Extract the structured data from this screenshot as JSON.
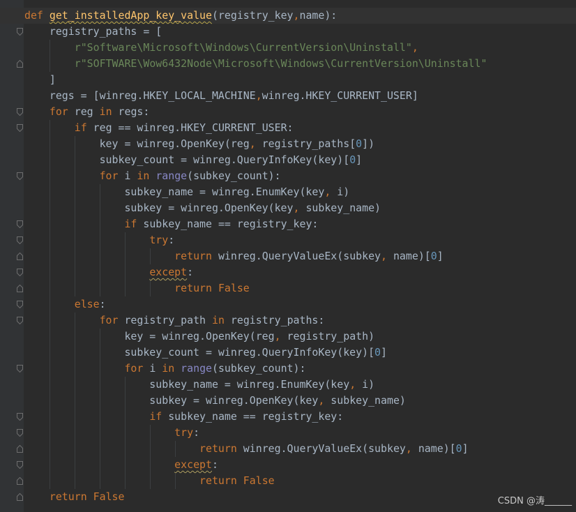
{
  "editor": {
    "language": "python",
    "colors": {
      "background": "#2b2b2b",
      "gutter": "#313335",
      "keyword": "#cc7832",
      "function": "#ffc66d",
      "string": "#6a8759",
      "number": "#6897bb",
      "builtin": "#8888c6",
      "default": "#a9b7c6"
    },
    "lines": [
      [
        {
          "t": "def ",
          "c": "kw"
        },
        {
          "t": "get_installedApp_key_value",
          "c": "fn-decl"
        },
        {
          "t": "(registry_key"
        },
        {
          "t": ",",
          "c": "punc"
        },
        {
          "t": "name):"
        }
      ],
      [
        {
          "t": "    registry_paths = ["
        }
      ],
      [
        {
          "t": "        "
        },
        {
          "t": "r\"Software\\Microsoft\\Windows\\CurrentVersion\\Uninstall\"",
          "c": "str"
        },
        {
          "t": ",",
          "c": "punc"
        }
      ],
      [
        {
          "t": "        "
        },
        {
          "t": "r\"SOFTWARE\\Wow6432Node\\Microsoft\\Windows\\CurrentVersion\\Uninstall\"",
          "c": "str"
        }
      ],
      [
        {
          "t": "    ]"
        }
      ],
      [
        {
          "t": "    regs = [winreg.HKEY_LOCAL_MACHINE"
        },
        {
          "t": ",",
          "c": "punc"
        },
        {
          "t": "winreg.HKEY_CURRENT_USER]"
        }
      ],
      [
        {
          "t": "    "
        },
        {
          "t": "for ",
          "c": "kw"
        },
        {
          "t": "reg "
        },
        {
          "t": "in ",
          "c": "kw"
        },
        {
          "t": "regs:"
        }
      ],
      [
        {
          "t": "        "
        },
        {
          "t": "if ",
          "c": "kw"
        },
        {
          "t": "reg == winreg.HKEY_CURRENT_USER:"
        }
      ],
      [
        {
          "t": "            key = winreg.OpenKey(reg"
        },
        {
          "t": ", ",
          "c": "punc"
        },
        {
          "t": "registry_paths["
        },
        {
          "t": "0",
          "c": "num"
        },
        {
          "t": "])"
        }
      ],
      [
        {
          "t": "            subkey_count = winreg.QueryInfoKey(key)["
        },
        {
          "t": "0",
          "c": "num"
        },
        {
          "t": "]"
        }
      ],
      [
        {
          "t": "            "
        },
        {
          "t": "for ",
          "c": "kw"
        },
        {
          "t": "i "
        },
        {
          "t": "in ",
          "c": "kw"
        },
        {
          "t": "range",
          "c": "builtin"
        },
        {
          "t": "(subkey_count):"
        }
      ],
      [
        {
          "t": "                subkey_name = winreg.EnumKey(key"
        },
        {
          "t": ", ",
          "c": "punc"
        },
        {
          "t": "i)"
        }
      ],
      [
        {
          "t": "                subkey = winreg.OpenKey(key"
        },
        {
          "t": ", ",
          "c": "punc"
        },
        {
          "t": "subkey_name)"
        }
      ],
      [
        {
          "t": "                "
        },
        {
          "t": "if ",
          "c": "kw"
        },
        {
          "t": "subkey_name == registry_key:"
        }
      ],
      [
        {
          "t": "                    "
        },
        {
          "t": "try",
          "c": "kw"
        },
        {
          "t": ":"
        }
      ],
      [
        {
          "t": "                        "
        },
        {
          "t": "return ",
          "c": "kw"
        },
        {
          "t": "winreg.QueryValueEx(subkey"
        },
        {
          "t": ", ",
          "c": "punc"
        },
        {
          "t": "name)["
        },
        {
          "t": "0",
          "c": "num"
        },
        {
          "t": "]"
        }
      ],
      [
        {
          "t": "                    "
        },
        {
          "t": "except",
          "c": "kw warn"
        },
        {
          "t": ":"
        }
      ],
      [
        {
          "t": "                        "
        },
        {
          "t": "return ",
          "c": "kw"
        },
        {
          "t": "False",
          "c": "kw"
        }
      ],
      [
        {
          "t": "        "
        },
        {
          "t": "else",
          "c": "kw"
        },
        {
          "t": ":"
        }
      ],
      [
        {
          "t": "            "
        },
        {
          "t": "for ",
          "c": "kw"
        },
        {
          "t": "registry_path "
        },
        {
          "t": "in ",
          "c": "kw"
        },
        {
          "t": "registry_paths:"
        }
      ],
      [
        {
          "t": "                key = winreg.OpenKey(reg"
        },
        {
          "t": ", ",
          "c": "punc"
        },
        {
          "t": "registry_path)"
        }
      ],
      [
        {
          "t": "                subkey_count = winreg.QueryInfoKey(key)["
        },
        {
          "t": "0",
          "c": "num"
        },
        {
          "t": "]"
        }
      ],
      [
        {
          "t": "                "
        },
        {
          "t": "for ",
          "c": "kw"
        },
        {
          "t": "i "
        },
        {
          "t": "in ",
          "c": "kw"
        },
        {
          "t": "range",
          "c": "builtin"
        },
        {
          "t": "(subkey_count):"
        }
      ],
      [
        {
          "t": "                    subkey_name = winreg.EnumKey(key"
        },
        {
          "t": ", ",
          "c": "punc"
        },
        {
          "t": "i)"
        }
      ],
      [
        {
          "t": "                    subkey = winreg.OpenKey(key"
        },
        {
          "t": ", ",
          "c": "punc"
        },
        {
          "t": "subkey_name)"
        }
      ],
      [
        {
          "t": "                    "
        },
        {
          "t": "if ",
          "c": "kw"
        },
        {
          "t": "subkey_name == registry_key:"
        }
      ],
      [
        {
          "t": "                        "
        },
        {
          "t": "try",
          "c": "kw"
        },
        {
          "t": ":"
        }
      ],
      [
        {
          "t": "                            "
        },
        {
          "t": "return ",
          "c": "kw"
        },
        {
          "t": "winreg.QueryValueEx(subkey"
        },
        {
          "t": ", ",
          "c": "punc"
        },
        {
          "t": "name)["
        },
        {
          "t": "0",
          "c": "num"
        },
        {
          "t": "]"
        }
      ],
      [
        {
          "t": "                        "
        },
        {
          "t": "except",
          "c": "kw warn"
        },
        {
          "t": ":"
        }
      ],
      [
        {
          "t": "                            "
        },
        {
          "t": "return ",
          "c": "kw"
        },
        {
          "t": "False",
          "c": "kw"
        }
      ],
      [
        {
          "t": "    "
        },
        {
          "t": "return ",
          "c": "kw"
        },
        {
          "t": "False",
          "c": "kw"
        }
      ]
    ]
  },
  "watermark": {
    "text": "CSDN @涛______"
  }
}
